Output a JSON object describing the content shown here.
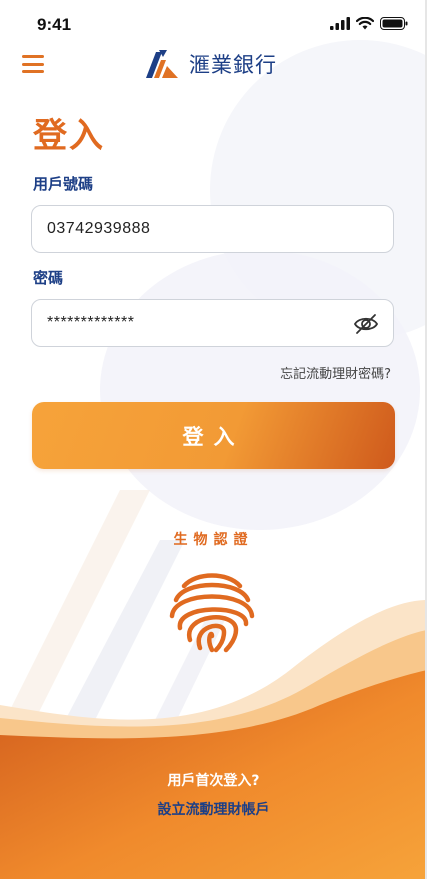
{
  "status_bar": {
    "time": "9:41"
  },
  "header": {
    "brand_name": "滙業銀行"
  },
  "login": {
    "title": "登入",
    "account_label": "用戶號碼",
    "account_value": "03742939888",
    "password_label": "密碼",
    "password_value": "*************",
    "forgot_link": "忘記流動理財密碼?",
    "login_button": "登入"
  },
  "biometric": {
    "label": "生物認證"
  },
  "footer": {
    "first_login": "用戶首次登入?",
    "setup_link": "設立流動理財帳戶"
  },
  "colors": {
    "accent_orange": "#e06a20",
    "brand_blue": "#1d3f86",
    "button_gradient_start": "#f6a33a",
    "button_gradient_end": "#cf5a1c"
  },
  "icons": {
    "menu": "hamburger-icon",
    "eye": "eye-slash-icon",
    "fingerprint": "fingerprint-icon"
  }
}
